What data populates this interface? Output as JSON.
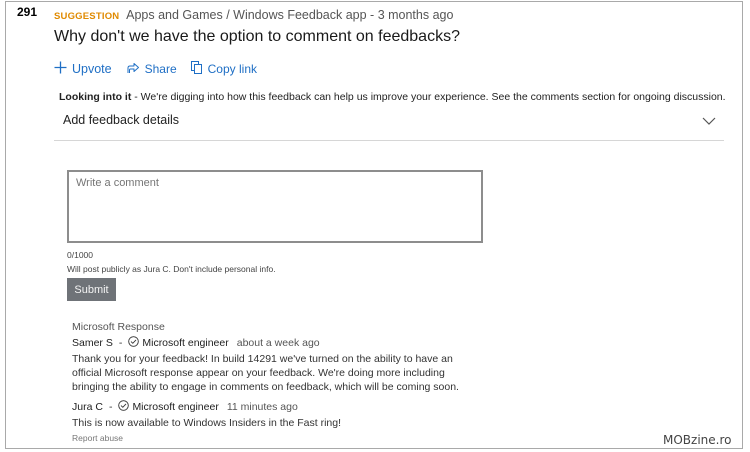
{
  "vote_count": "291",
  "meta": {
    "tag": "SUGGESTION",
    "category": "Apps and Games / Windows Feedback app",
    "separator": "-",
    "age": "3 months ago"
  },
  "title": "Why don't we have the option to comment on feedbacks?",
  "actions": {
    "upvote": "Upvote",
    "share": "Share",
    "copy_link": "Copy link"
  },
  "status": {
    "label": "Looking into it",
    "text": " - We're digging into how this feedback can help us improve your experience. See the comments section for ongoing discussion."
  },
  "details": {
    "label": "Add feedback details"
  },
  "comment": {
    "placeholder": "Write a comment",
    "count": "0/1000",
    "hint": "Will post publicly as Jura C. Don't include personal info.",
    "submit_label": "Submit"
  },
  "response": {
    "heading": "Microsoft Response",
    "entries": [
      {
        "author": "Samer S",
        "separator": "-",
        "role": "Microsoft engineer",
        "time": "about a week ago",
        "lines": [
          "Thank you for your feedback!  In build 14291 we've turned on the ability to have an",
          "official Microsoft response appear on your feedback.  We're doing more including",
          "bringing the ability to engage in comments on feedback, which will be coming soon."
        ]
      },
      {
        "author": "Jura C",
        "separator": "-",
        "role": "Microsoft engineer",
        "time": "11 minutes ago",
        "lines": [
          "This is now available to Windows Insiders in the Fast ring!"
        ]
      }
    ],
    "report": "Report abuse"
  },
  "watermark": "MOBzine.ro",
  "icons": {
    "upvote": "plus-icon",
    "share": "share-icon",
    "copy": "copy-icon",
    "expand": "chevron-down-icon",
    "verified": "check-circle-icon"
  },
  "colors": {
    "link": "#1f6fc5",
    "tag": "#e08a00",
    "submit_bg": "#6f7378"
  }
}
